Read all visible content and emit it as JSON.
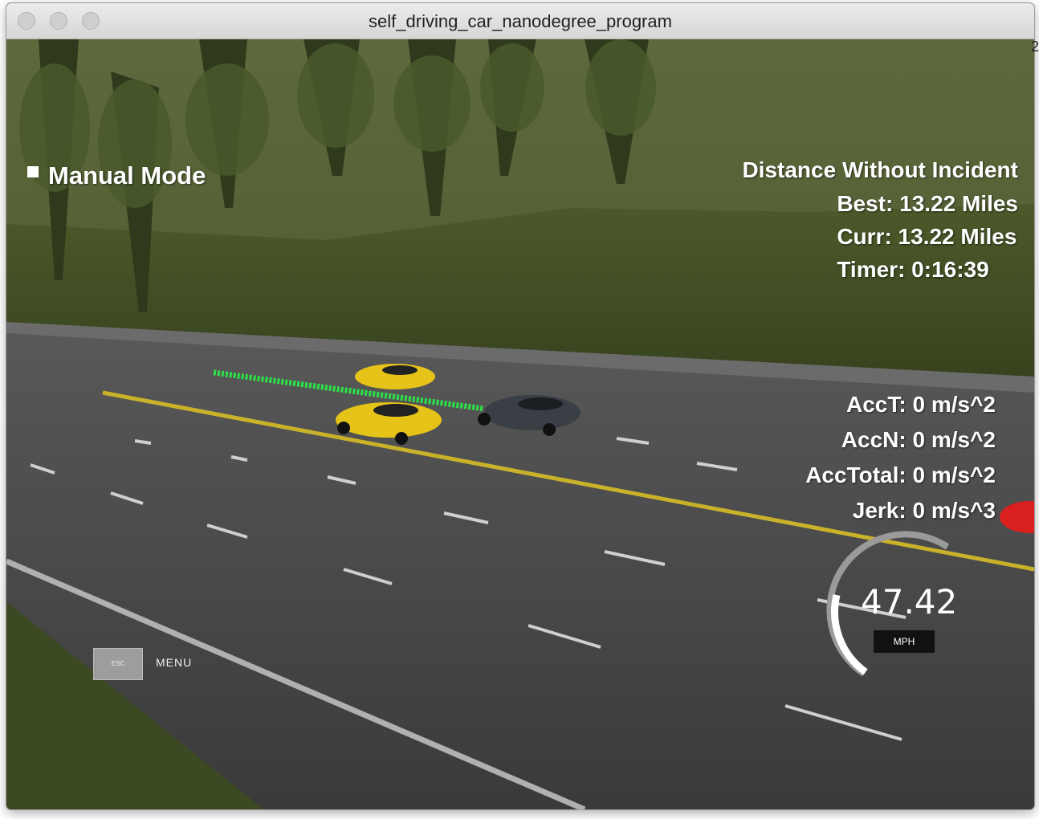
{
  "window": {
    "title": "self_driving_car_nanodegree_program"
  },
  "hud": {
    "mode_label": "Manual Mode",
    "distance_title": "Distance Without Incident",
    "best": "Best: 13.22 Miles",
    "curr": "Curr: 13.22 Miles",
    "timer": "Timer: 0:16:39",
    "acc_t": "AccT: 0 m/s^2",
    "acc_n": "AccN: 0 m/s^2",
    "acc_total": "AccTotal: 0 m/s^2",
    "jerk": "Jerk: 0 m/s^3"
  },
  "speedometer": {
    "value": "47.42",
    "unit": "MPH"
  },
  "controls": {
    "esc_key": "ESC",
    "menu_label": "MENU"
  },
  "edge_mark": "2",
  "colors": {
    "path": "#2de04a",
    "ego_car": "#3a3f45",
    "traffic_car": "#e6c318",
    "red_car": "#d9201e"
  }
}
